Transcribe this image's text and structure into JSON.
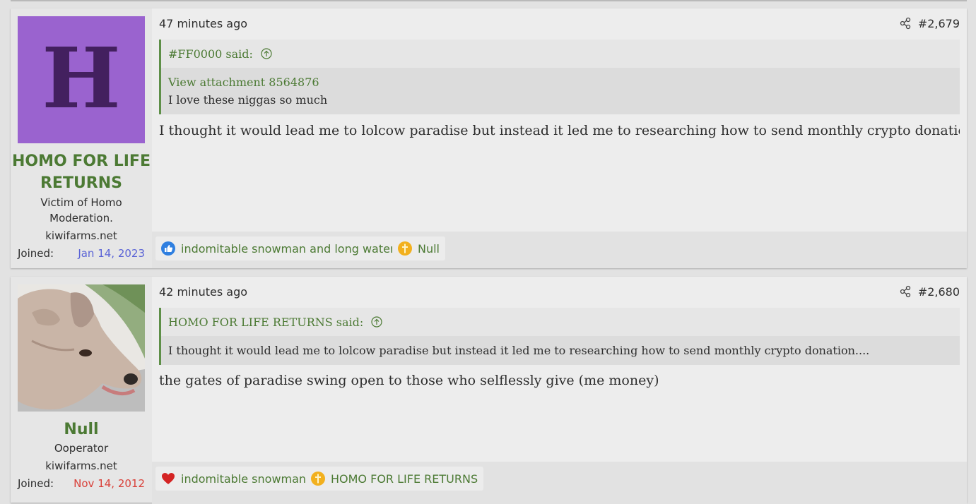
{
  "posts": [
    {
      "user": {
        "avatar_letter": "H",
        "name_line1": "HOMO FOR LIFE",
        "name_line2": "RETURNS",
        "title_line1": "Victim of Homo",
        "title_line2": "Moderation.",
        "site": "kiwifarms.net",
        "joined_label": "Joined:",
        "joined_date": "Jan 14, 2023",
        "joined_color": "#5a63d6"
      },
      "time": "47 minutes ago",
      "number": "#2,679",
      "quote": {
        "author": "#FF0000 said:",
        "attachment": "View attachment 8564876",
        "text": "I love these niggas so much"
      },
      "message": "I thought it would lead me to lolcow paradise but instead it led me to researching how to send monthly crypto donation....",
      "reactions": [
        {
          "icon": "like-icon",
          "text": "indomitable snowman and long waters"
        },
        {
          "icon": "cross-icon",
          "text": "Null"
        }
      ]
    },
    {
      "user": {
        "name": "Null",
        "title": "Ooperator",
        "site": "kiwifarms.net",
        "joined_label": "Joined:",
        "joined_date": "Nov 14, 2012",
        "joined_color": "#d9413a"
      },
      "time": "42 minutes ago",
      "number": "#2,680",
      "quote": {
        "author": "HOMO FOR LIFE RETURNS said:",
        "text": "I thought it would lead me to lolcow paradise but instead it led me to researching how to send monthly crypto donation...."
      },
      "message": "the gates of paradise swing open to those who selflessly give (me money)",
      "reactions": [
        {
          "icon": "heart-icon",
          "text": "indomitable snowman"
        },
        {
          "icon": "cross-icon",
          "text": "HOMO FOR LIFE RETURNS"
        }
      ]
    }
  ],
  "colors": {
    "accent_green": "#4c7a34",
    "avatar_purple": "#9a63cf"
  }
}
